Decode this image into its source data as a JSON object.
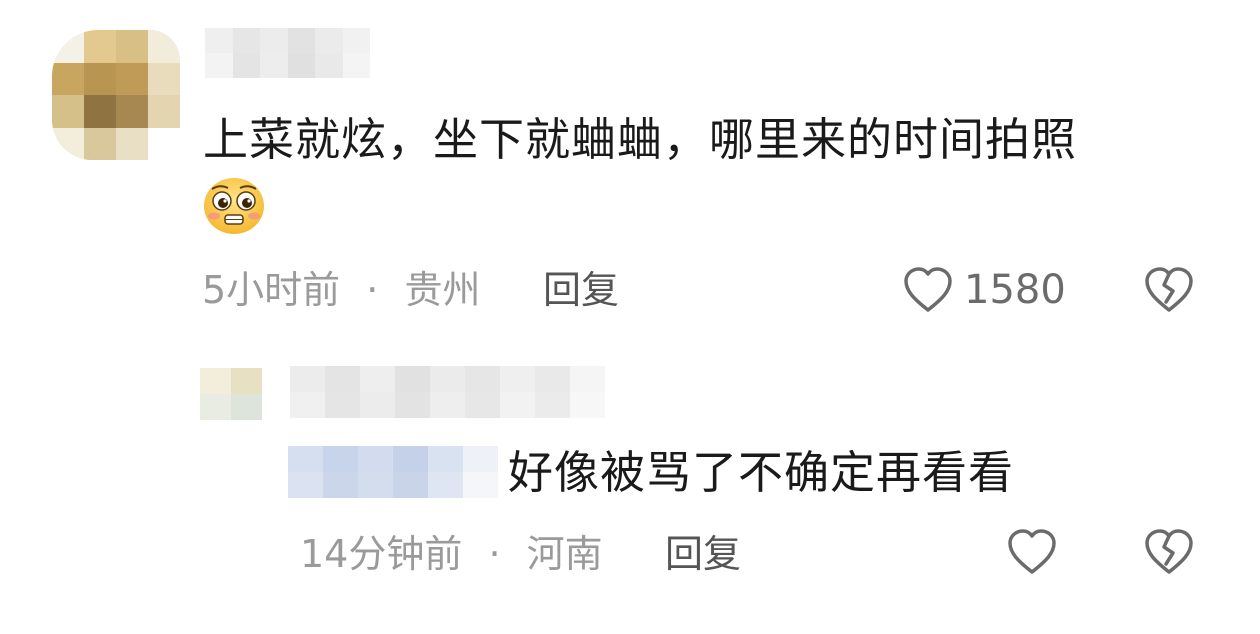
{
  "comment": {
    "text": "上菜就炫，坐下就蛐蛐，哪里来的时间拍照",
    "emoji": "pleading-face-emoji",
    "time": "5小时前",
    "location": "贵州",
    "reply_label": "回复",
    "likes": "1580"
  },
  "reply": {
    "text": "好像被骂了不确定再看看",
    "time": "14分钟前",
    "location": "河南",
    "reply_label": "回复"
  },
  "separator": "·",
  "colors": {
    "text": "#1a1a1a",
    "meta": "#9a9a9a",
    "reply": "#555555",
    "icon": "#6b6b6b"
  }
}
